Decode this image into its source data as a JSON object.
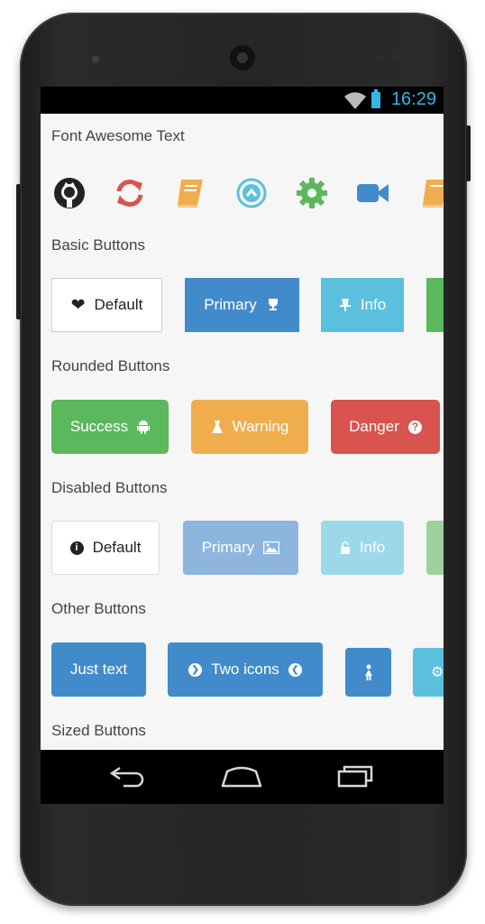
{
  "status": {
    "time": "16:29"
  },
  "sections": {
    "font_awesome_text": "Font Awesome Text",
    "basic_buttons": "Basic Buttons",
    "rounded_buttons": "Rounded Buttons",
    "disabled_buttons": "Disabled Buttons",
    "other_buttons": "Other Buttons",
    "sized_buttons": "Sized Buttons"
  },
  "icons": [
    "github-icon",
    "refresh-icon",
    "book-icon",
    "chevron-circle-up-icon",
    "gear-icon",
    "video-camera-icon",
    "book-icon"
  ],
  "basic_buttons": {
    "default": "Default",
    "primary": "Primary",
    "info": "Info"
  },
  "rounded_buttons": {
    "success": "Success",
    "warning": "Warning",
    "danger": "Danger"
  },
  "disabled_buttons": {
    "default": "Default",
    "primary": "Primary",
    "info": "Info"
  },
  "other_buttons": {
    "just_text": "Just text",
    "two_icons": "Two icons"
  },
  "colors": {
    "primary": "#428bca",
    "info": "#5bc0de",
    "success": "#5cb85c",
    "warning": "#f0ad4e",
    "danger": "#d9534f",
    "status_accent": "#33b5e5"
  }
}
